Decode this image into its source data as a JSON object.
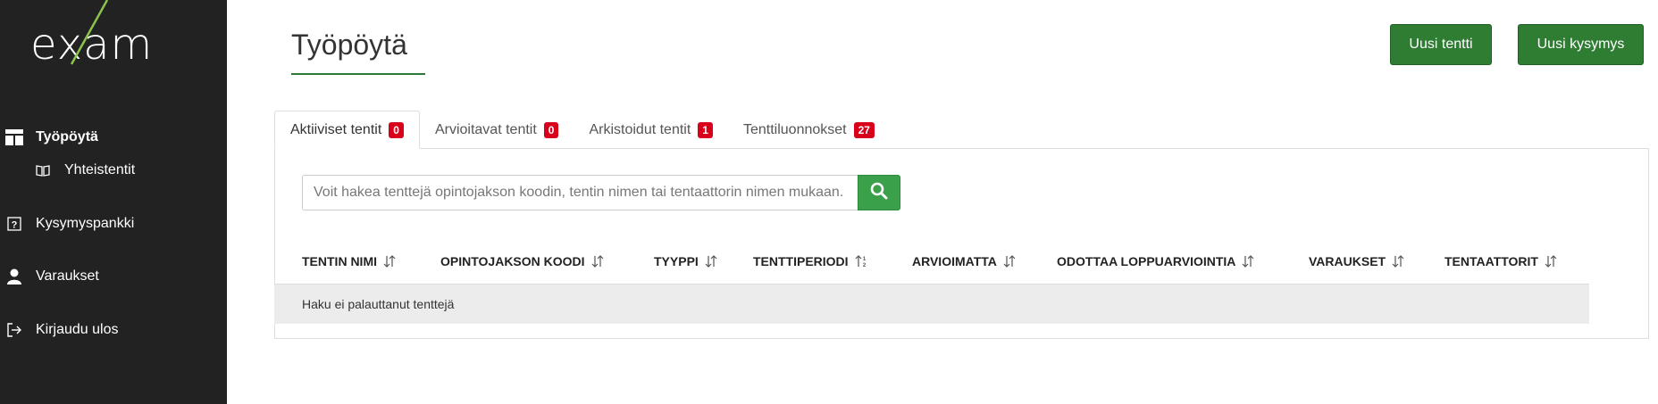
{
  "sidebar": {
    "logo_text": "exam",
    "items": [
      {
        "label": "Työpöytä",
        "icon": "dashboard-icon",
        "active": true
      },
      {
        "label": "Yhteistentit",
        "icon": "book-icon",
        "sub": true
      },
      {
        "label": "Kysymyspankki",
        "icon": "question-box-icon"
      },
      {
        "label": "Varaukset",
        "icon": "user-icon"
      },
      {
        "label": "Kirjaudu ulos",
        "icon": "logout-icon"
      }
    ]
  },
  "header": {
    "title": "Työpöytä",
    "new_exam_label": "Uusi tentti",
    "new_question_label": "Uusi kysymys"
  },
  "tabs": [
    {
      "label": "Aktiiviset tentit",
      "count": "0",
      "active": true
    },
    {
      "label": "Arvioitavat tentit",
      "count": "0"
    },
    {
      "label": "Arkistoidut tentit",
      "count": "1"
    },
    {
      "label": "Tenttiluonnokset",
      "count": "27"
    }
  ],
  "search": {
    "placeholder": "Voit hakea tenttejä opintojakson koodin, tentin nimen tai tentaattorin nimen mukaan.",
    "value": "",
    "button_icon": "search-icon"
  },
  "table": {
    "columns": [
      "TENTIN NIMI",
      "OPINTOJAKSON KOODI",
      "TYYPPI",
      "TENTTIPERIODI",
      "ARVIOIMATTA",
      "ODOTTAA LOPPUARVIOINTIA",
      "VARAUKSET",
      "TENTAATTORIT"
    ],
    "empty_message": "Haku ei palauttanut tenttejä"
  },
  "colors": {
    "sidebar_bg": "#222222",
    "primary_green": "#2e7d32",
    "search_green": "#3aa04a",
    "badge_red": "#d9001b",
    "logo_accent": "#8bc34a"
  }
}
